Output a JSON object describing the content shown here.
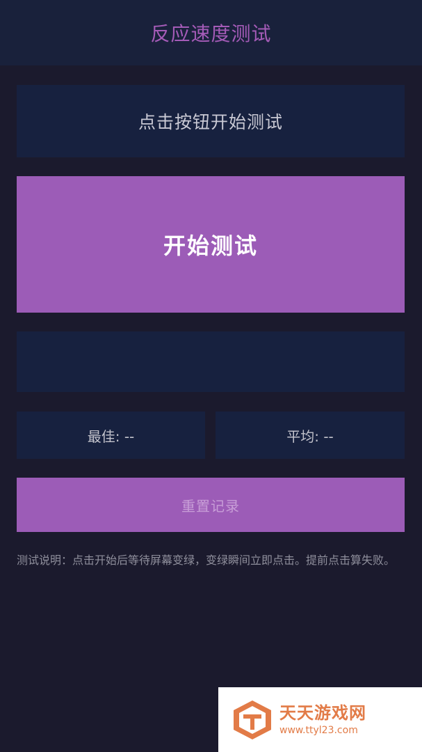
{
  "header": {
    "title": "反应速度测试"
  },
  "status": {
    "text": "点击按钮开始测试"
  },
  "start_button": {
    "label": "开始测试"
  },
  "result": {
    "text": ""
  },
  "stats": {
    "best": "最佳: --",
    "average": "平均: --"
  },
  "reset_button": {
    "label": "重置记录"
  },
  "instructions": {
    "text": "测试说明：点击开始后等待屏幕变绿，变绿瞬间立即点击。提前点击算失败。"
  },
  "watermark": {
    "name": "天天游戏网",
    "url": "www.ttyl23.com"
  },
  "colors": {
    "accent": "#9c5cb7",
    "background": "#1b1a2d",
    "panel": "#17213f",
    "watermark": "#e27b47"
  }
}
